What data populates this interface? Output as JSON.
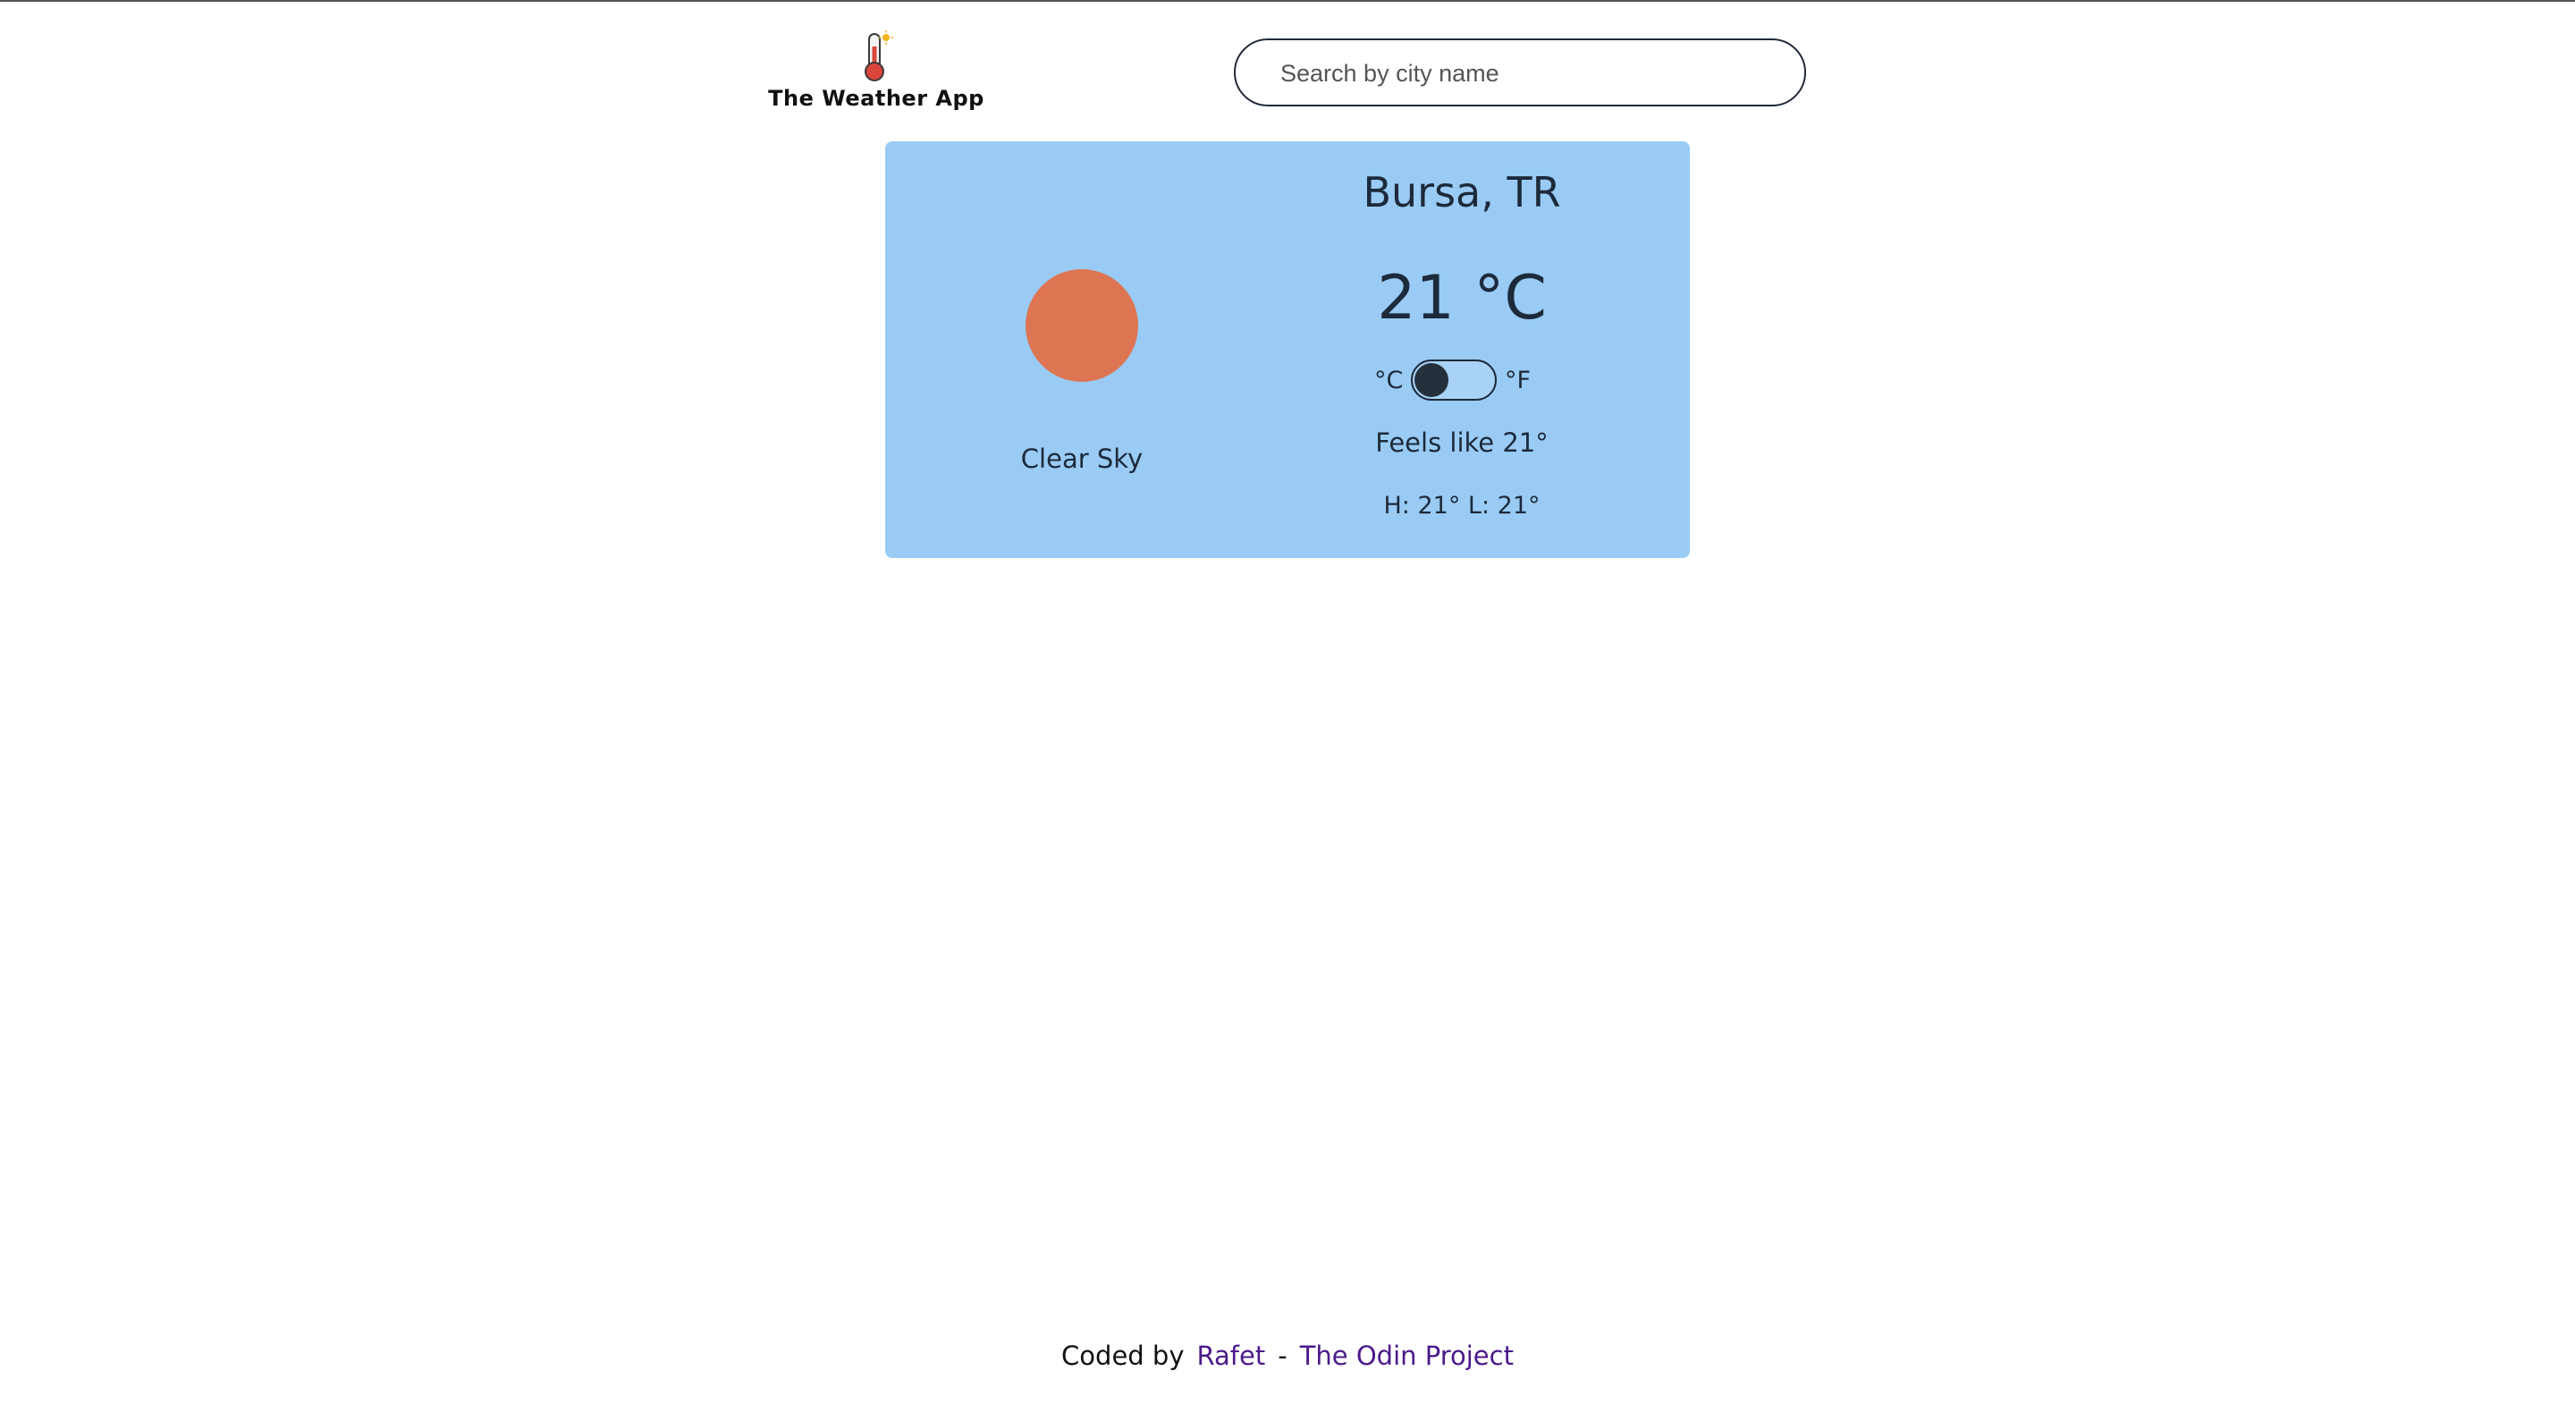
{
  "header": {
    "app_title": "The Weather App",
    "logo_icon": "thermometer-sun-icon"
  },
  "search": {
    "placeholder": "Search by city name",
    "value": ""
  },
  "weather": {
    "location": "Bursa, TR",
    "temperature": "21 °C",
    "condition": "Clear Sky",
    "condition_icon": "sun-icon",
    "sun_color": "#de7552",
    "card_color": "#99cbf4",
    "unit_toggle": {
      "celsius_label": "°C",
      "fahrenheit_label": "°F",
      "selected": "celsius"
    },
    "feels_like": "Feels like 21°",
    "high_low": "H: 21° L: 21°"
  },
  "footer": {
    "coded_by": "Coded by",
    "author": "Rafet",
    "separator": "-",
    "project": "The Odin Project",
    "link_color": "#4b1a8a"
  }
}
